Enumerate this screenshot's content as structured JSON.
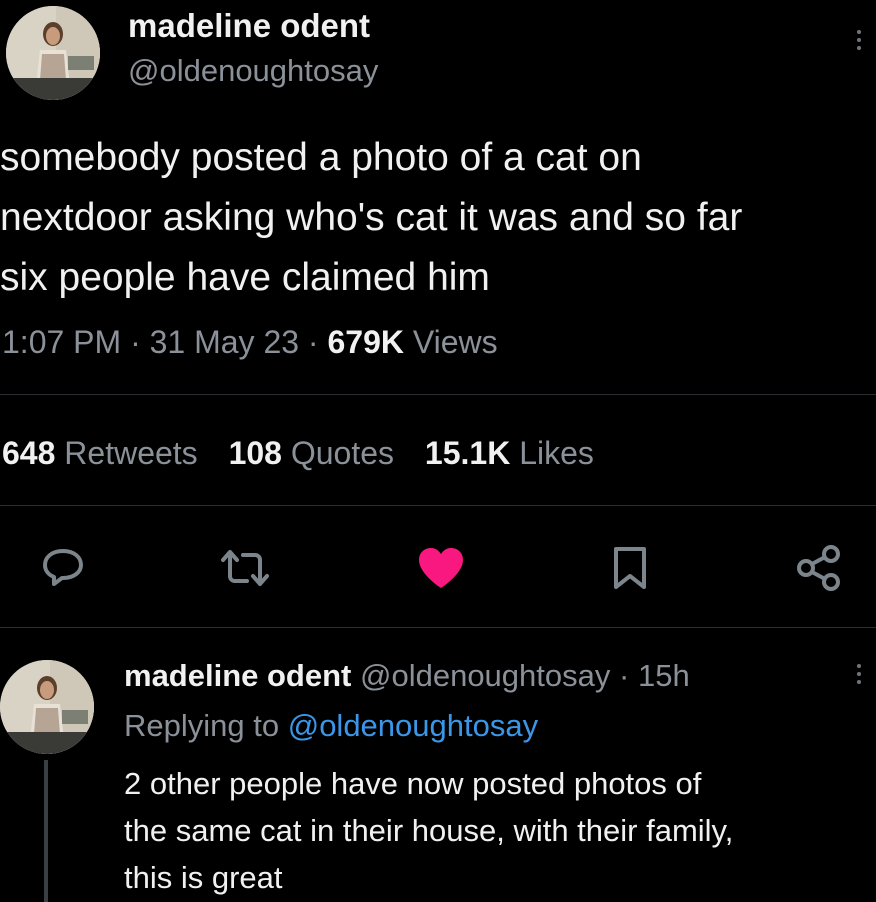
{
  "tweet": {
    "author": {
      "name": "madeline odent",
      "handle": "@oldenoughtosay"
    },
    "text_lines": [
      "somebody posted a photo of a cat on",
      "nextdoor asking who's cat it was and so far",
      "six people have claimed him"
    ],
    "time": "1:07 PM",
    "date": "31 May 23",
    "views_count": "679K",
    "views_label": "Views",
    "separator": "·",
    "stats": {
      "retweets_count": "648",
      "retweets_label": "Retweets",
      "quotes_count": "108",
      "quotes_label": "Quotes",
      "likes_count": "15.1K",
      "likes_label": "Likes"
    },
    "actions": {
      "reply_icon": "reply-icon",
      "retweet_icon": "retweet-icon",
      "like_icon": "heart-icon",
      "bookmark_icon": "bookmark-icon",
      "share_icon": "share-icon",
      "liked": true
    }
  },
  "reply": {
    "author": {
      "name": "madeline odent",
      "handle": "@oldenoughtosay"
    },
    "separator": "·",
    "age": "15h",
    "replying_prefix": "Replying to",
    "replying_handle": "@oldenoughtosay",
    "text_lines": [
      "2 other people have now posted photos of",
      "the same cat in their house, with their family,",
      "this is great"
    ]
  },
  "colors": {
    "background": "#000000",
    "text": "#e7e9ea",
    "muted": "#8b9198",
    "link": "#3b96e8",
    "like": "#f91880"
  }
}
